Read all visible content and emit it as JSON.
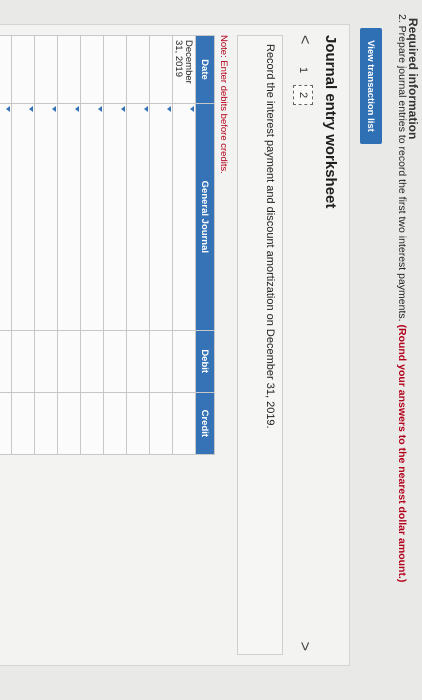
{
  "header": {
    "cutoff_text": "Required information"
  },
  "question": {
    "text": "2. Prepare journal entries to record the first two interest payments.",
    "emphasis": "(Round your answers to the nearest dollar amount.)"
  },
  "view_transaction_label": "View transaction list",
  "worksheet": {
    "title": "Journal entry worksheet",
    "nav_prev": "<",
    "nav_next": ">",
    "pages": [
      "1",
      "2"
    ],
    "instruction": "Record the interest payment and discount amortization on December 31, 2019.",
    "note": "Note: Enter debits before credits."
  },
  "journal": {
    "headers": {
      "date": "Date",
      "account": "General Journal",
      "debit": "Debit",
      "credit": "Credit"
    },
    "rows": [
      {
        "date": "December 31, 2019",
        "account": "",
        "debit": "",
        "credit": ""
      },
      {
        "date": "",
        "account": "",
        "debit": "",
        "credit": ""
      },
      {
        "date": "",
        "account": "",
        "debit": "",
        "credit": ""
      },
      {
        "date": "",
        "account": "",
        "debit": "",
        "credit": ""
      },
      {
        "date": "",
        "account": "",
        "debit": "",
        "credit": ""
      },
      {
        "date": "",
        "account": "",
        "debit": "",
        "credit": ""
      },
      {
        "date": "",
        "account": "",
        "debit": "",
        "credit": ""
      },
      {
        "date": "",
        "account": "",
        "debit": "",
        "credit": ""
      },
      {
        "date": "",
        "account": "",
        "debit": "",
        "credit": ""
      },
      {
        "date": "",
        "account": "",
        "debit": "",
        "credit": ""
      },
      {
        "date": "",
        "account": "",
        "debit": "",
        "credit": ""
      }
    ]
  },
  "colors": {
    "accent": "#3573b6",
    "emphasis": "#b3001b"
  }
}
